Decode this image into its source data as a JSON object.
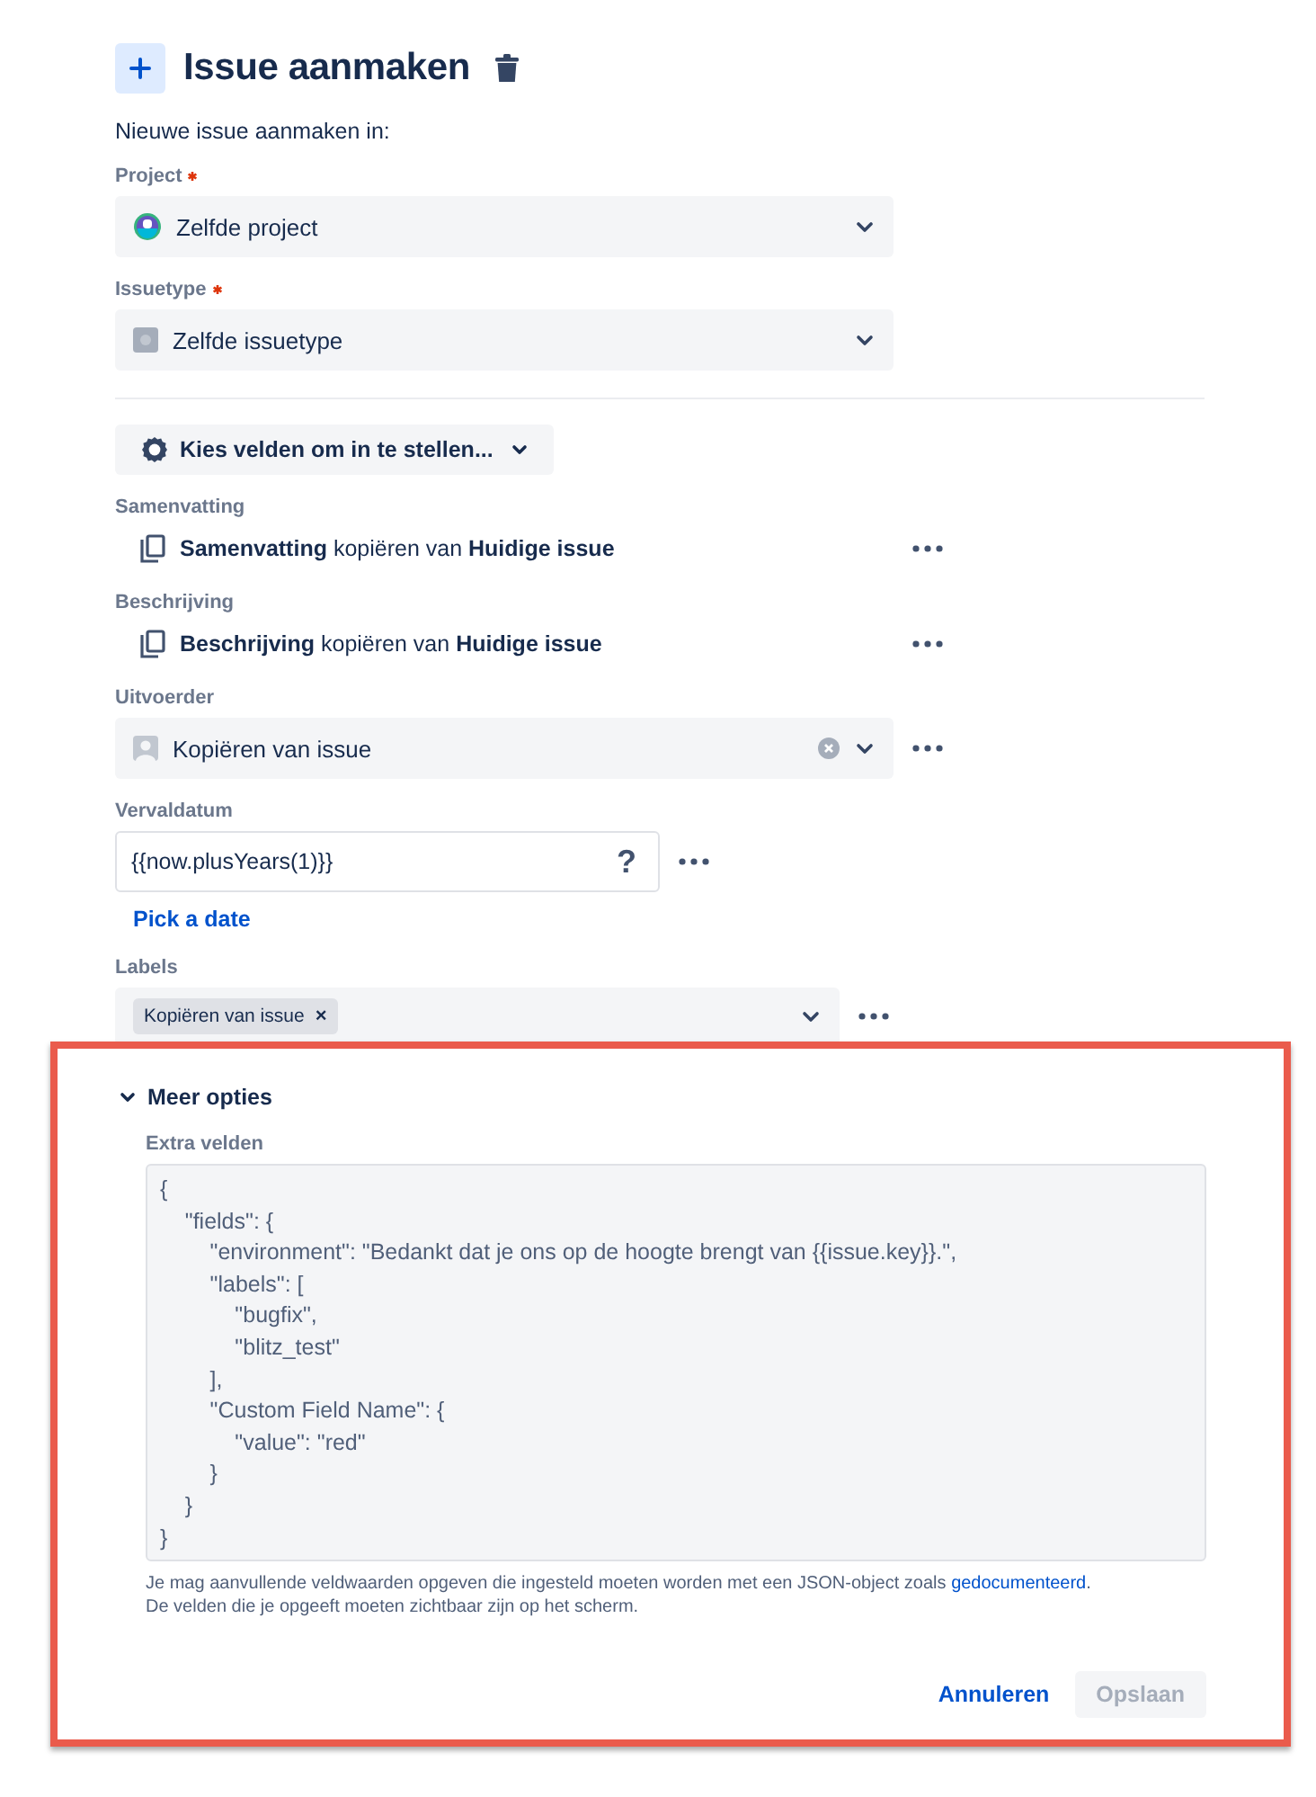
{
  "header": {
    "title": "Issue aanmaken",
    "subtitle": "Nieuwe issue aanmaken in:"
  },
  "selects": [
    {
      "kind": "project",
      "label": "Project",
      "required": true,
      "value": "Zelfde project"
    },
    {
      "kind": "issuetype",
      "label": "Issuetype",
      "required": true,
      "value": "Zelfde issuetype"
    }
  ],
  "field_picker": {
    "label": "Kies velden om in te stellen..."
  },
  "fields": [
    {
      "kind": "copy",
      "label": "Samenvatting",
      "text": "**Samenvatting** kopiëren van **Huidige issue**"
    },
    {
      "kind": "copy",
      "label": "Beschrijving",
      "text": "**Beschrijving** kopiëren van **Huidige issue**"
    },
    {
      "kind": "user",
      "label": "Uitvoerder",
      "value": "Kopiëren van issue"
    },
    {
      "kind": "date",
      "label": "Vervaldatum",
      "value": "{{now.plusYears(1)}}",
      "help": "?",
      "link": "Pick a date"
    },
    {
      "kind": "labels",
      "label": "Labels",
      "tags": [
        {
          "text": "Kopiëren van issue",
          "remove": "×"
        }
      ]
    }
  ],
  "more_options": {
    "title": "Meer opties",
    "expanded": true,
    "label": "Extra velden",
    "code": [
      "{",
      "    \"fields\": {",
      "        \"environment\": \"Bedankt dat je ons op de hoogte brengt van {{issue.key}}.\",",
      "        \"labels\": [",
      "            \"bugfix\",",
      "            \"blitz_test\"",
      "        ],",
      "        \"Custom Field Name\": {",
      "            \"value\": \"red\"",
      "        }",
      "    }",
      "}"
    ],
    "help_before": "Je mag aanvullende veldwaarden opgeven die ingesteld moeten worden met een JSON-object zoals",
    "help_link": "gedocumenteerd",
    "help_after": ".",
    "help_line2": "De velden die je opgeeft moeten zichtbaar zijn op het scherm."
  },
  "buttons": [
    {
      "kind": "link",
      "label": "Annuleren",
      "disabled": false
    },
    {
      "kind": "primary",
      "label": "Opslaan",
      "disabled": true
    }
  ]
}
